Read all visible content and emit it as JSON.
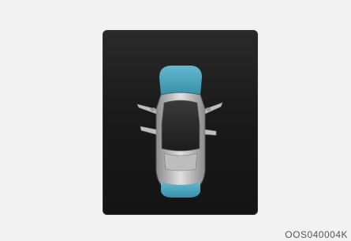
{
  "image_code": "OOS040004K",
  "display": {
    "state": "doors-open-alert",
    "open_doors": [
      "front-left",
      "front-right",
      "rear-left",
      "rear-right"
    ],
    "hood_open": true,
    "tailgate_open": true,
    "alert_color": "#4aa8c0",
    "body_color": "#c8c8c8",
    "panel_color": "#1a1a1a"
  }
}
